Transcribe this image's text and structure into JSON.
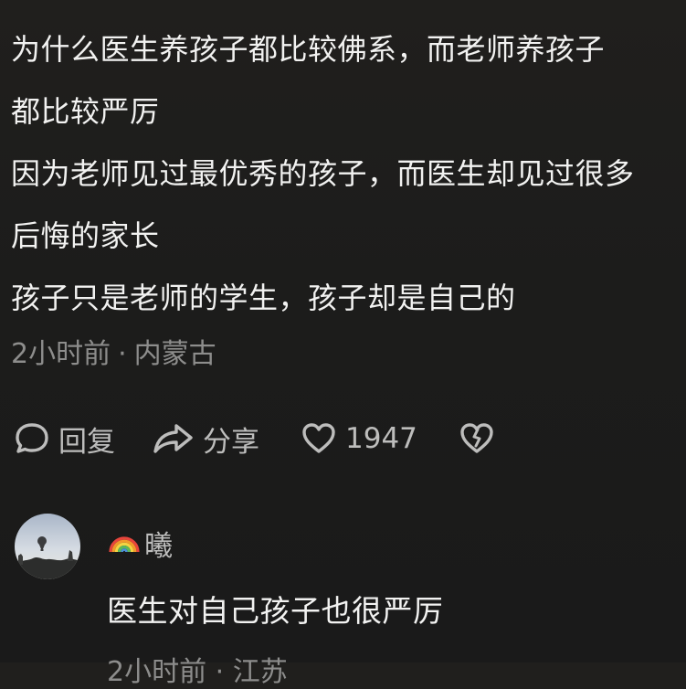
{
  "comment": {
    "lines": [
      "为什么医生养孩子都比较佛系，而老师养孩子",
      "都比较严厉",
      "因为老师见过最优秀的孩子，而医生却见过很多",
      "后悔的家长",
      "孩子只是老师的学生，孩子却是自己的"
    ],
    "time": "2小时前",
    "separator": "·",
    "location": "内蒙古"
  },
  "actions": {
    "reply_label": "回复",
    "share_label": "分享",
    "like_count": "1947"
  },
  "reply": {
    "username": "曦",
    "username_emoji": "rainbow-icon",
    "text": "医生对自己孩子也很严厉",
    "meta": "2小时前 · 江苏"
  },
  "colors": {
    "background": "#1c1c1b",
    "primary_text": "#f2f2f1",
    "secondary_text": "#8d8d8c",
    "icon": "#bdbdbc"
  }
}
